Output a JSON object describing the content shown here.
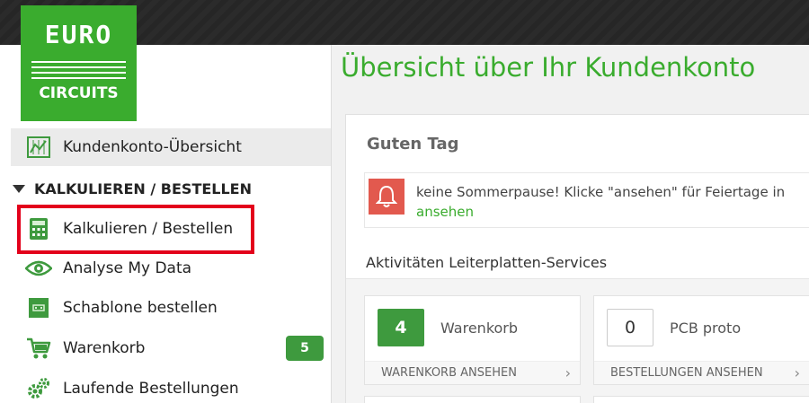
{
  "logo": {
    "line1": "EURO",
    "line2": "CIRCUITS"
  },
  "sidebar": {
    "overview_label": "Kundenkonto-Übersicht",
    "section_label": "KALKULIEREN / BESTELLEN",
    "items": [
      {
        "label": "Kalkulieren / Bestellen",
        "icon": "calculator-icon"
      },
      {
        "label": "Analyse My Data",
        "icon": "eye-icon"
      },
      {
        "label": "Schablone bestellen",
        "icon": "stencil-icon"
      },
      {
        "label": "Warenkorb",
        "icon": "cart-icon",
        "badge": "5"
      },
      {
        "label": "Laufende Bestellungen",
        "icon": "gears-icon"
      }
    ]
  },
  "main": {
    "title": "Übersicht über Ihr Kundenkonto",
    "greeting": "Guten Tag",
    "notice": {
      "message": "keine Sommerpause! Klicke \"ansehen\" für Feiertage in",
      "link": "ansehen"
    },
    "activities_title": "Aktivitäten Leiterplatten-Services",
    "cards": [
      {
        "count": "4",
        "name": "Warenkorb",
        "footer": "WARENKORB ANSEHEN"
      },
      {
        "count": "0",
        "name": "PCB proto",
        "footer": "BESTELLUNGEN ANSEHEN"
      }
    ]
  },
  "colors": {
    "brand_green": "#3aac2e",
    "highlight_red": "#e3001b",
    "bell_red": "#e2594e"
  }
}
